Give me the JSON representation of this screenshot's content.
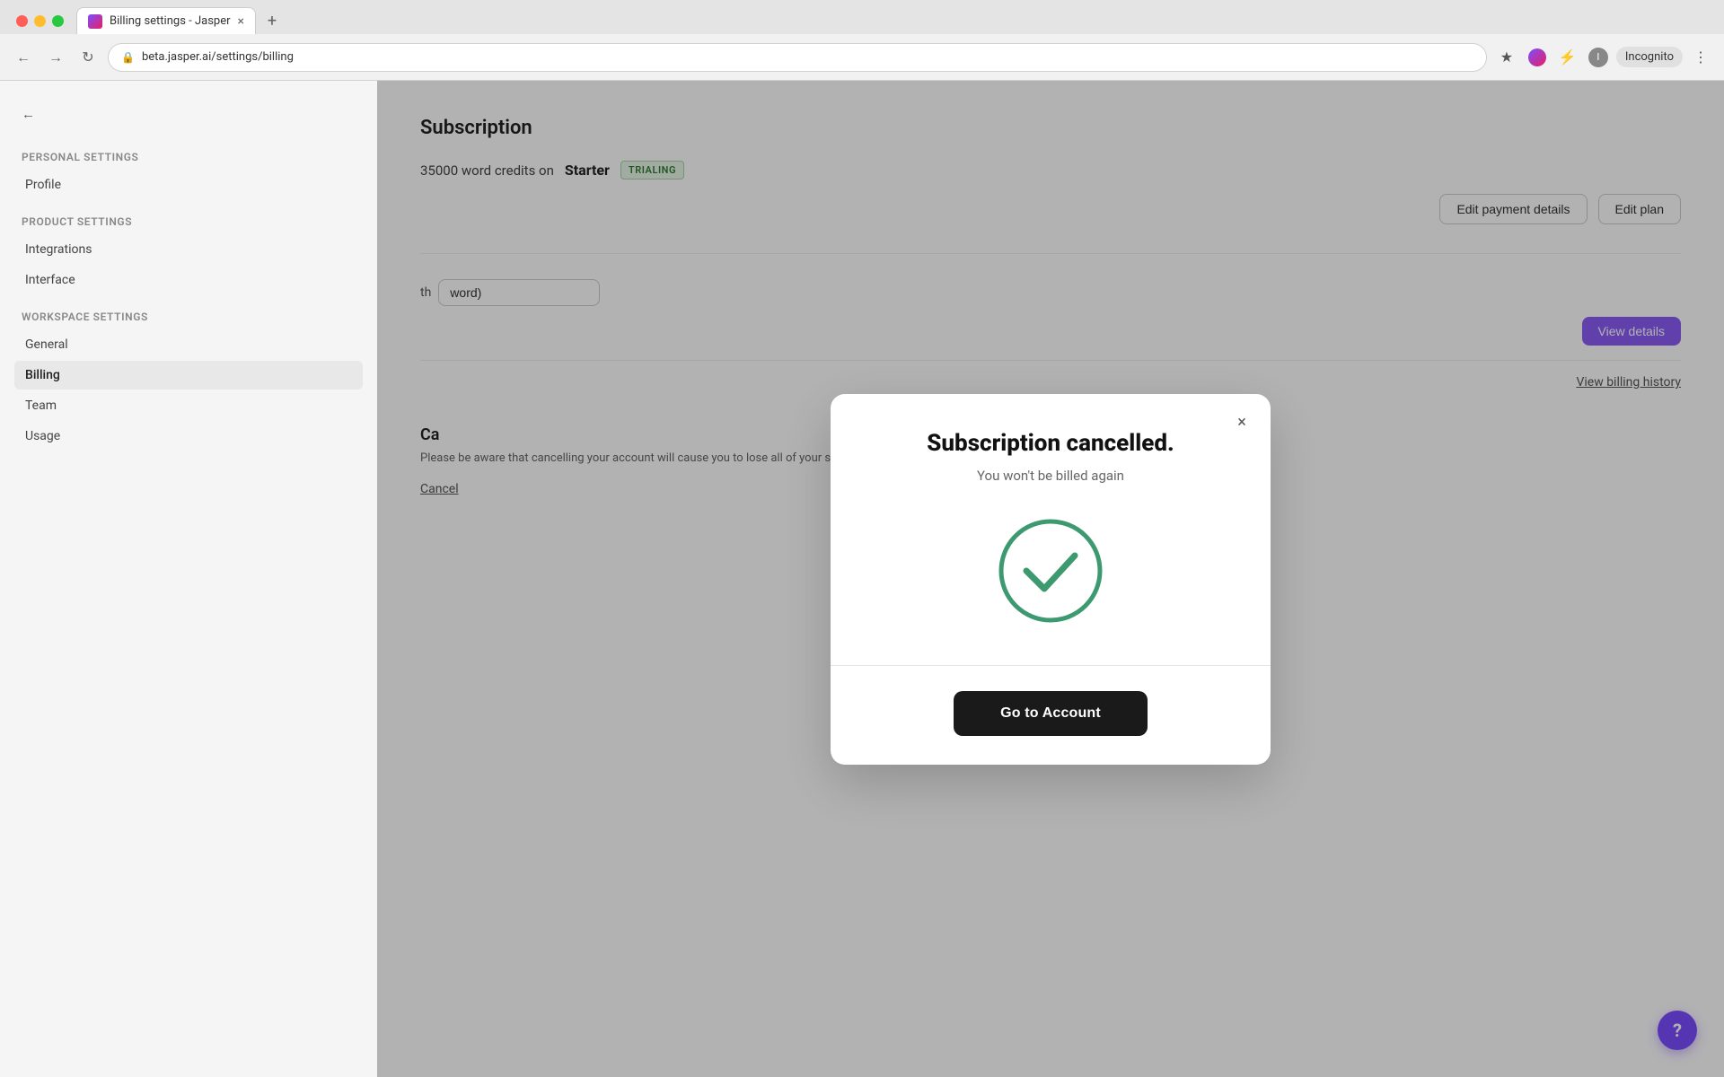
{
  "browser": {
    "tab_title": "Billing settings - Jasper",
    "url": "beta.jasper.ai/settings/billing",
    "incognito_label": "Incognito",
    "new_tab_label": "+"
  },
  "sidebar": {
    "back_label": "←",
    "personal_settings_title": "Personal settings",
    "profile_label": "Profile",
    "product_settings_title": "Product settings",
    "integrations_label": "Integrations",
    "interface_label": "Interface",
    "workspace_settings_title": "Workspace settings",
    "general_label": "General",
    "billing_label": "Billing",
    "team_label": "Team",
    "usage_label": "Usage"
  },
  "main": {
    "page_title": "Subscription",
    "subscription_text": "35000 word credits  on",
    "plan_name": "Starter",
    "trialing_badge": "TRIALING",
    "edit_payment_label": "Edit payment details",
    "edit_plan_label": "Edit plan",
    "view_details_label": "View details",
    "view_billing_history_label": "View billing history",
    "cancel_title": "Ca",
    "cancel_warning": "Please be aware that cancelling your account will cause you to lose all of your saved content and earned credits on your account.",
    "cancel_btn_label": "Cancel"
  },
  "modal": {
    "title": "Subscription cancelled.",
    "subtitle": "You won't be billed again",
    "go_to_account_label": "Go to Account",
    "close_icon": "×"
  },
  "help": {
    "label": "?"
  }
}
